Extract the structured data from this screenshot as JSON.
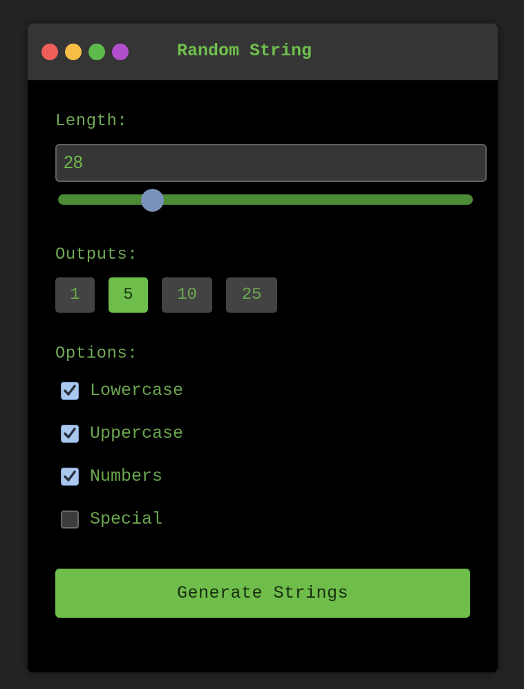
{
  "window": {
    "title": "Random String"
  },
  "length": {
    "label": "Length:",
    "value": "28",
    "slider_value": 28
  },
  "outputs": {
    "label": "Outputs:",
    "options": [
      "1",
      "5",
      "10",
      "25"
    ],
    "selected": "5"
  },
  "options": {
    "label": "Options:",
    "items": [
      {
        "label": "Lowercase",
        "checked": true
      },
      {
        "label": "Uppercase",
        "checked": true
      },
      {
        "label": "Numbers",
        "checked": true
      },
      {
        "label": "Special",
        "checked": false
      }
    ]
  },
  "generate_button": {
    "label": "Generate Strings"
  },
  "colors": {
    "accent": "#6fbd4b",
    "background": "#000000",
    "titlebar": "#353535"
  }
}
